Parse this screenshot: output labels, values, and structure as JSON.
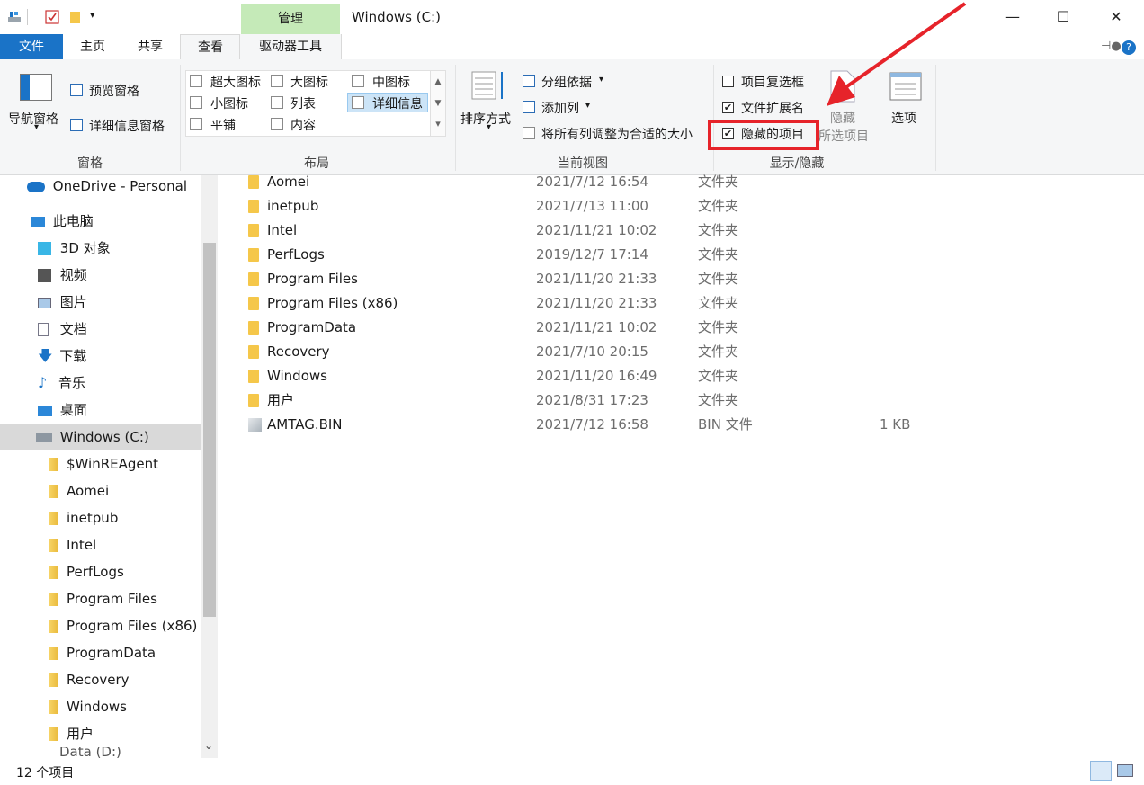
{
  "title_bar": {
    "context_tab": "管理",
    "window_title": "Windows (C:)",
    "minimize": "—",
    "maximize": "☐",
    "close": "✕"
  },
  "ribbon_tabs": {
    "file": "文件",
    "home": "主页",
    "share": "共享",
    "view": "查看",
    "drive_tools": "驱动器工具"
  },
  "pane_group": {
    "nav_pane": "导航窗格",
    "preview_pane": "预览窗格",
    "details_pane": "详细信息窗格",
    "label": "窗格"
  },
  "layout_group": {
    "extra_large": "超大图标",
    "large": "大图标",
    "medium": "中图标",
    "small": "小图标",
    "list": "列表",
    "details": "详细信息",
    "tiles": "平铺",
    "content": "内容",
    "label": "布局"
  },
  "current_view_group": {
    "sort_by": "排序方式",
    "group_by": "分组依据",
    "add_columns": "添加列",
    "size_all_columns": "将所有列调整为合适的大小",
    "label": "当前视图"
  },
  "show_hide_group": {
    "item_checkboxes": "项目复选框",
    "item_checkboxes_checked": "",
    "file_name_extensions": "文件扩展名",
    "file_name_extensions_checked": "✔",
    "hidden_items": "隐藏的项目",
    "hidden_items_checked": "✔",
    "hide_selected_line1": "隐藏",
    "hide_selected_line2": "所选项目",
    "label": "显示/隐藏"
  },
  "options": {
    "label": "选项"
  },
  "nav": {
    "onedrive": "OneDrive - Personal",
    "this_pc": "此电脑",
    "items": [
      {
        "label": "3D 对象"
      },
      {
        "label": "视频"
      },
      {
        "label": "图片"
      },
      {
        "label": "文档"
      },
      {
        "label": "下载"
      },
      {
        "label": "音乐"
      },
      {
        "label": "桌面"
      }
    ],
    "drive_c": "Windows (C:)",
    "sub_folders": [
      {
        "label": "$WinREAgent"
      },
      {
        "label": "Aomei"
      },
      {
        "label": "inetpub"
      },
      {
        "label": "Intel"
      },
      {
        "label": "PerfLogs"
      },
      {
        "label": "Program Files"
      },
      {
        "label": "Program Files (x86)"
      },
      {
        "label": "ProgramData"
      },
      {
        "label": "Recovery"
      },
      {
        "label": "Windows"
      },
      {
        "label": "用户"
      }
    ],
    "partial": "Data (D:)"
  },
  "files": [
    {
      "name": "Aomei",
      "date": "2021/7/12 16:54",
      "type": "文件夹",
      "size": ""
    },
    {
      "name": "inetpub",
      "date": "2021/7/13 11:00",
      "type": "文件夹",
      "size": ""
    },
    {
      "name": "Intel",
      "date": "2021/11/21 10:02",
      "type": "文件夹",
      "size": ""
    },
    {
      "name": "PerfLogs",
      "date": "2019/12/7 17:14",
      "type": "文件夹",
      "size": ""
    },
    {
      "name": "Program Files",
      "date": "2021/11/20 21:33",
      "type": "文件夹",
      "size": ""
    },
    {
      "name": "Program Files (x86)",
      "date": "2021/11/20 21:33",
      "type": "文件夹",
      "size": ""
    },
    {
      "name": "ProgramData",
      "date": "2021/11/21 10:02",
      "type": "文件夹",
      "size": ""
    },
    {
      "name": "Recovery",
      "date": "2021/7/10 20:15",
      "type": "文件夹",
      "size": ""
    },
    {
      "name": "Windows",
      "date": "2021/11/20 16:49",
      "type": "文件夹",
      "size": ""
    },
    {
      "name": "用户",
      "date": "2021/8/31 17:23",
      "type": "文件夹",
      "size": ""
    },
    {
      "name": "AMTAG.BIN",
      "date": "2021/7/12 16:58",
      "type": "BIN 文件",
      "size": "1 KB"
    }
  ],
  "status": {
    "item_count": "12 个项目"
  },
  "colors": {
    "accent": "#1a73c7",
    "highlight": "#e6232a",
    "context_tab": "#c5eab8"
  }
}
